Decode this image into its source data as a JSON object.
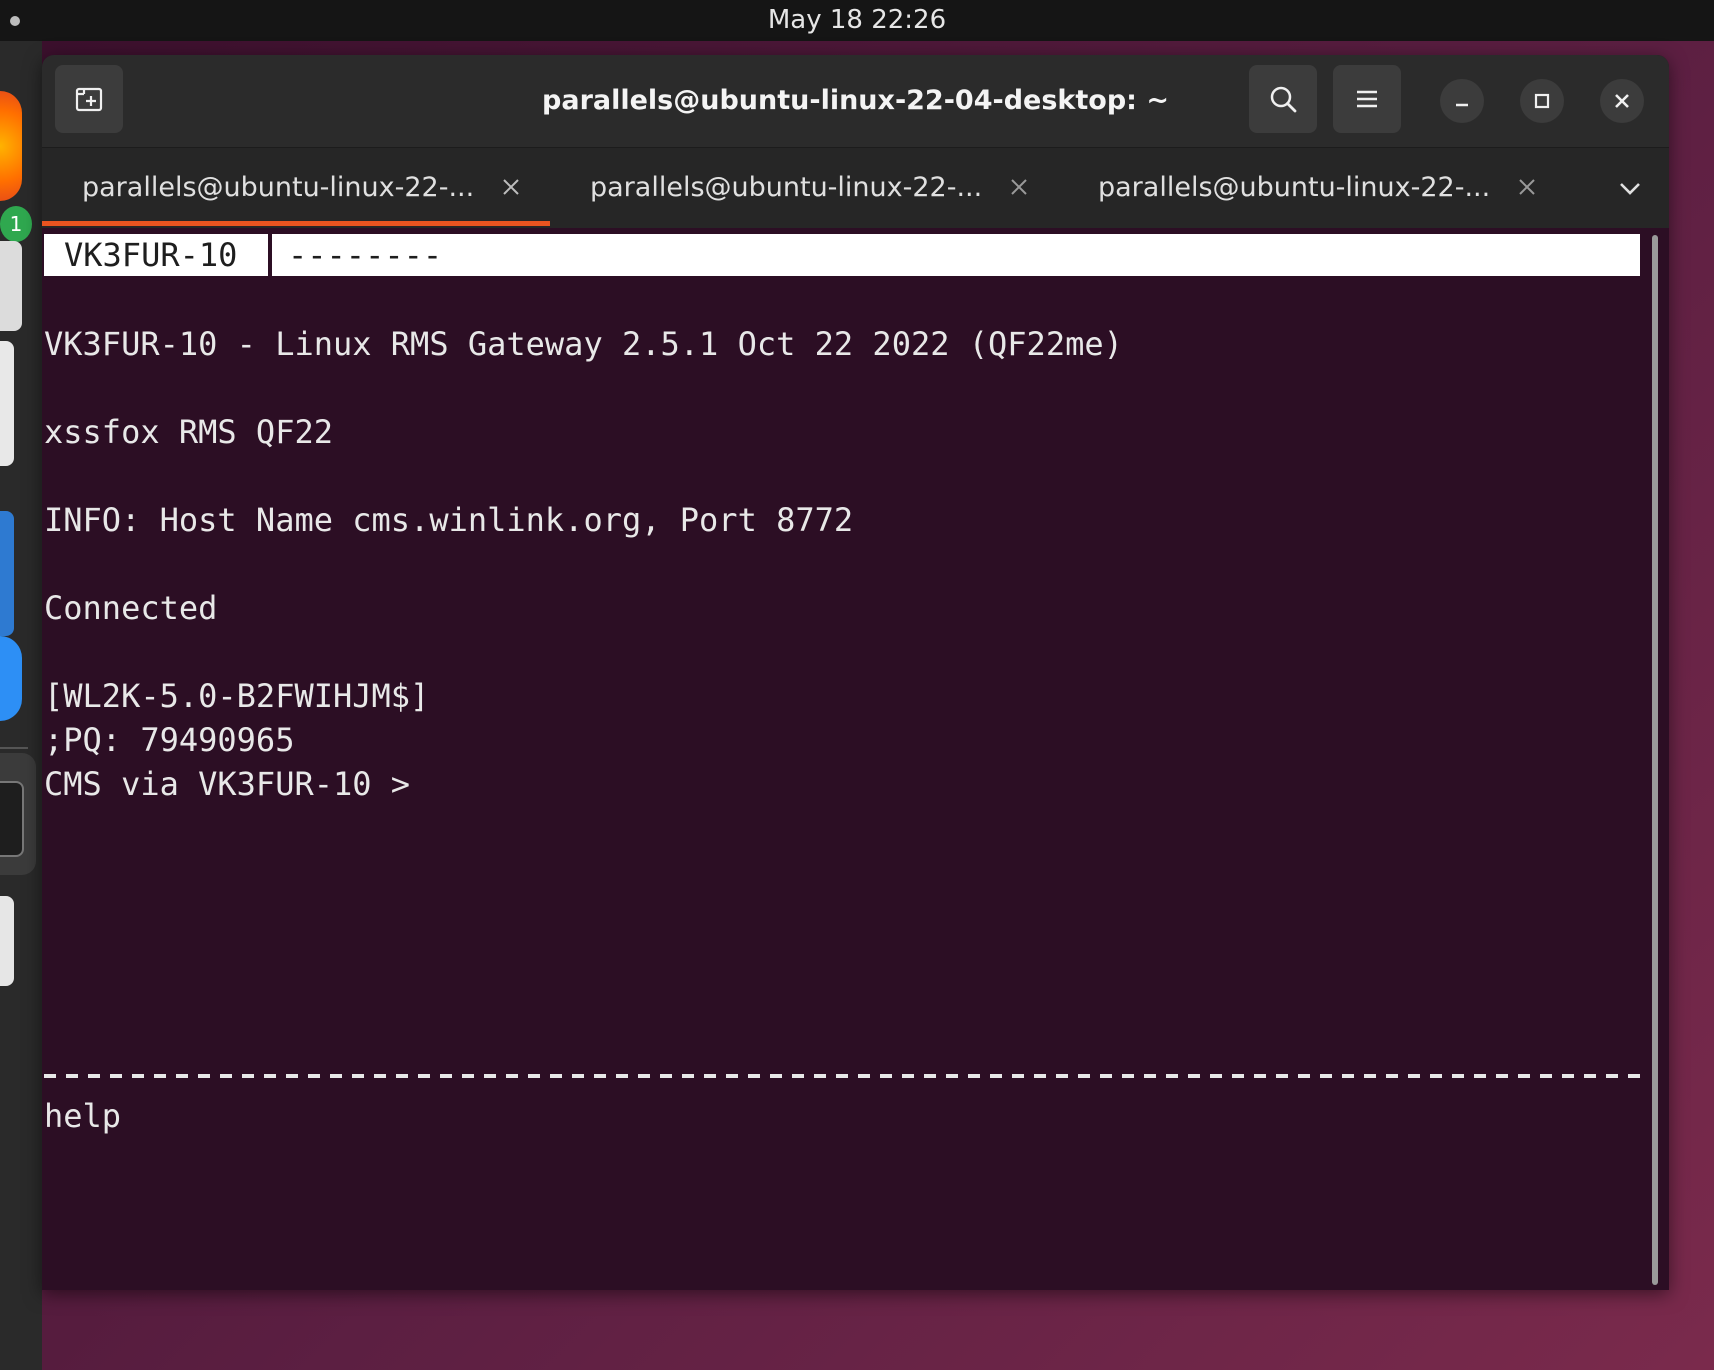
{
  "topbar": {
    "clock": "May 18  22:26"
  },
  "dock": {
    "badge": "1"
  },
  "window": {
    "title": "parallels@ubuntu-linux-22-04-desktop: ~"
  },
  "tabs": [
    {
      "label": "parallels@ubuntu-linux-22-...",
      "active": true
    },
    {
      "label": "parallels@ubuntu-linux-22-...",
      "active": false
    },
    {
      "label": "parallels@ubuntu-linux-22-...",
      "active": false
    }
  ],
  "terminal": {
    "status_left": "VK3FUR-10",
    "status_right": "--------",
    "lines": [
      "VK3FUR-10 - Linux RMS Gateway 2.5.1 Oct 22 2022 (QF22me)",
      "xssfox RMS QF22",
      "INFO: Host Name cms.winlink.org, Port 8772",
      "Connected",
      "[WL2K-5.0-B2FWIHJM$]",
      ";PQ: 79490965",
      "CMS via VK3FUR-10 >"
    ],
    "input": "help"
  },
  "icons": {
    "new_tab": "new-tab-icon",
    "search": "search-icon",
    "menu": "hamburger-menu-icon",
    "minimize": "minimize-icon",
    "maximize": "maximize-icon",
    "close": "close-icon",
    "tab_close": "close-icon",
    "tab_dropdown": "chevron-down-icon"
  },
  "colors": {
    "terminal_bg": "#2c0e24",
    "tab_accent": "#e95420"
  }
}
